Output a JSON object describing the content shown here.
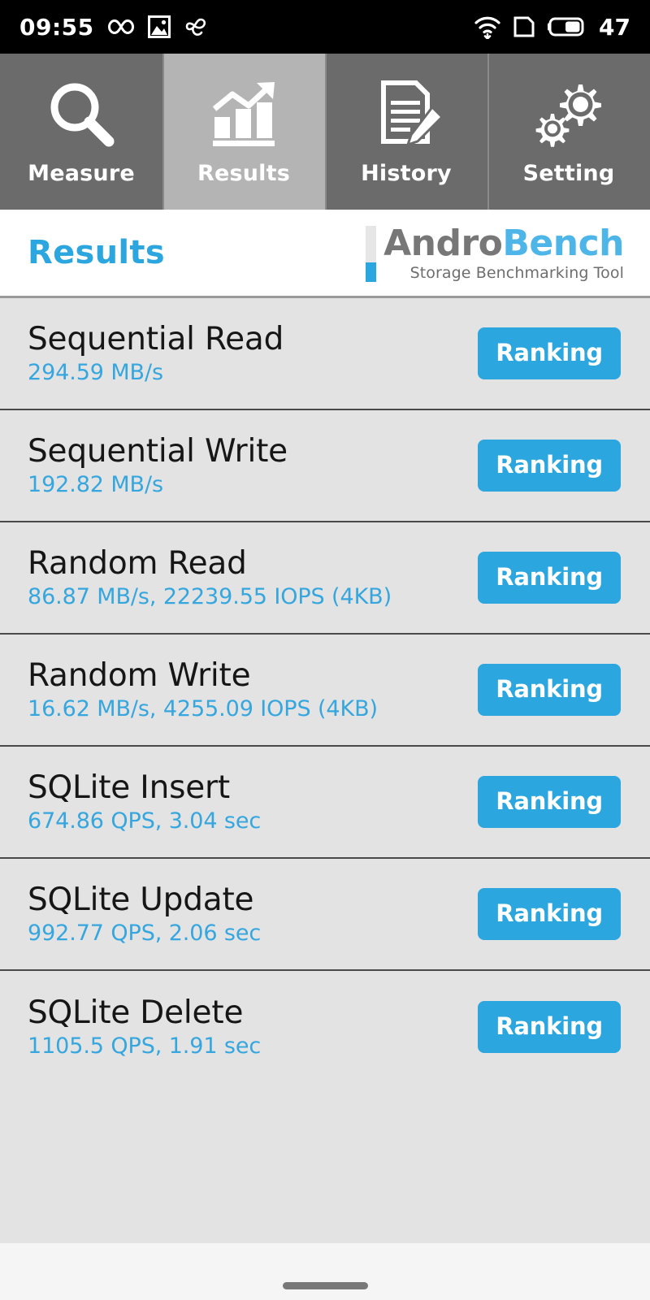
{
  "status_bar": {
    "time": "09:55",
    "battery_percent": "47",
    "icons": [
      "infinity-icon",
      "image-icon",
      "ribbon-loop-icon",
      "wifi-download-icon",
      "sim-card-icon",
      "battery-icon"
    ]
  },
  "tabs": [
    {
      "label": "Measure",
      "icon": "magnifier-icon",
      "active": false
    },
    {
      "label": "Results",
      "icon": "bar-chart-arrow-icon",
      "active": true
    },
    {
      "label": "History",
      "icon": "document-pencil-icon",
      "active": false
    },
    {
      "label": "Setting",
      "icon": "gears-icon",
      "active": false
    }
  ],
  "header": {
    "title": "Results",
    "logo_first": "Andro",
    "logo_second": "Bench",
    "logo_subtitle": "Storage Benchmarking Tool"
  },
  "results": [
    {
      "name": "Sequential Read",
      "value": "294.59 MB/s",
      "button": "Ranking"
    },
    {
      "name": "Sequential Write",
      "value": "192.82 MB/s",
      "button": "Ranking"
    },
    {
      "name": "Random Read",
      "value": "86.87 MB/s, 22239.55 IOPS (4KB)",
      "button": "Ranking"
    },
    {
      "name": "Random Write",
      "value": "16.62 MB/s, 4255.09 IOPS (4KB)",
      "button": "Ranking"
    },
    {
      "name": "SQLite Insert",
      "value": "674.86 QPS, 3.04 sec",
      "button": "Ranking"
    },
    {
      "name": "SQLite Update",
      "value": "992.77 QPS, 2.06 sec",
      "button": "Ranking"
    },
    {
      "name": "SQLite Delete",
      "value": "1105.5 QPS, 1.91 sec",
      "button": "Ranking"
    }
  ],
  "colors": {
    "accent_blue": "#2ba6de",
    "value_blue": "#35a6de",
    "tab_inactive": "#6b6b6b",
    "tab_active": "#b4b4b4",
    "list_bg": "#e3e3e3",
    "status_bar_bg": "#000000"
  }
}
